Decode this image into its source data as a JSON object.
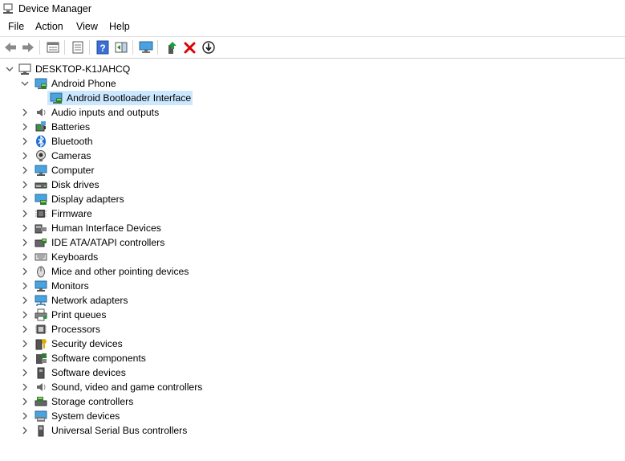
{
  "window": {
    "title": "Device Manager"
  },
  "menu": [
    "File",
    "Action",
    "View",
    "Help"
  ],
  "toolbar": [
    "back",
    "forward",
    "properties",
    "update-view",
    "help",
    "action-pane",
    "scan-hardware",
    "enable-device",
    "uninstall-device",
    "update-driver"
  ],
  "tree": {
    "root": "DESKTOP-K1JAHCQ",
    "android_phone": {
      "label": "Android Phone",
      "child": "Android Bootloader Interface"
    },
    "categories": [
      {
        "label": "Audio inputs and outputs",
        "icon": "speaker-icon"
      },
      {
        "label": "Batteries",
        "icon": "battery-icon"
      },
      {
        "label": "Bluetooth",
        "icon": "bluetooth-icon"
      },
      {
        "label": "Cameras",
        "icon": "camera-icon"
      },
      {
        "label": "Computer",
        "icon": "computer-icon"
      },
      {
        "label": "Disk drives",
        "icon": "disk-drive-icon"
      },
      {
        "label": "Display adapters",
        "icon": "display-adapter-icon"
      },
      {
        "label": "Firmware",
        "icon": "firmware-chip-icon"
      },
      {
        "label": "Human Interface Devices",
        "icon": "hid-icon"
      },
      {
        "label": "IDE ATA/ATAPI controllers",
        "icon": "ide-controller-icon"
      },
      {
        "label": "Keyboards",
        "icon": "keyboard-icon"
      },
      {
        "label": "Mice and other pointing devices",
        "icon": "mouse-icon"
      },
      {
        "label": "Monitors",
        "icon": "monitor-icon"
      },
      {
        "label": "Network adapters",
        "icon": "network-adapter-icon"
      },
      {
        "label": "Print queues",
        "icon": "printer-icon"
      },
      {
        "label": "Processors",
        "icon": "processor-icon"
      },
      {
        "label": "Security devices",
        "icon": "security-device-icon"
      },
      {
        "label": "Software components",
        "icon": "software-component-icon"
      },
      {
        "label": "Software devices",
        "icon": "software-device-icon"
      },
      {
        "label": "Sound, video and game controllers",
        "icon": "sound-controller-icon"
      },
      {
        "label": "Storage controllers",
        "icon": "storage-controller-icon"
      },
      {
        "label": "System devices",
        "icon": "system-device-icon"
      },
      {
        "label": "Universal Serial Bus controllers",
        "icon": "usb-controller-icon"
      }
    ]
  },
  "colors": {
    "selection": "#cce8ff",
    "uninstall": "#e00000",
    "enable": "#1e9e3a",
    "help": "#3b6fd6"
  }
}
